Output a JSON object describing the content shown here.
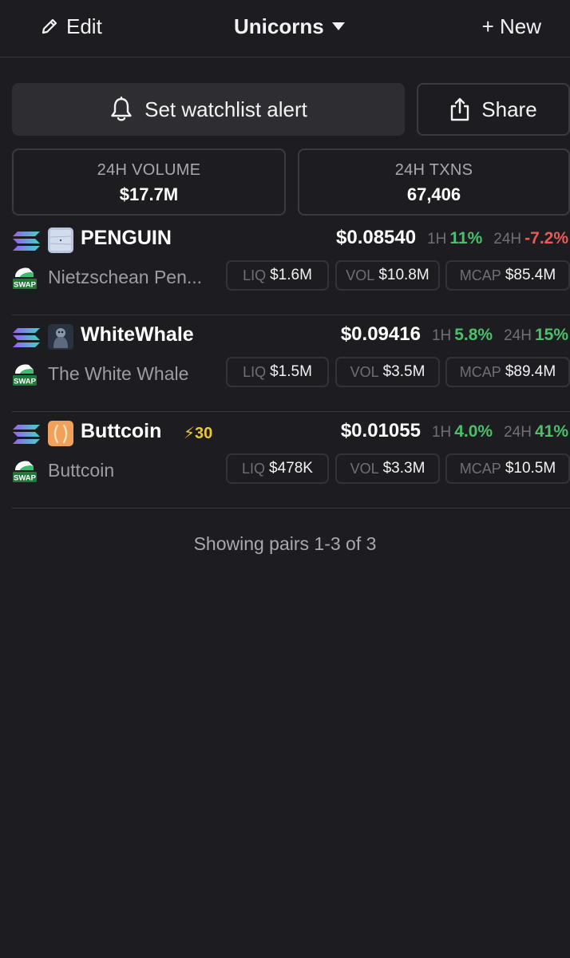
{
  "header": {
    "edit_label": "Edit",
    "title": "Unicorns",
    "new_label": "+ New"
  },
  "actions": {
    "alert_label": "Set watchlist alert",
    "share_label": "Share"
  },
  "stats": {
    "volume_label": "24H VOLUME",
    "volume_value": "$17.7M",
    "txns_label": "24H TXNS",
    "txns_value": "67,406"
  },
  "pairs": [
    {
      "symbol": "PENGUIN",
      "name": "Nietzschean Pen...",
      "boost": "",
      "price": "$0.08540",
      "h1_label": "1H",
      "h1_change": "11%",
      "h24_label": "24H",
      "h24_change": "-7.2%",
      "liq_label": "LIQ",
      "liq": "$1.6M",
      "vol_label": "VOL",
      "vol": "$10.8M",
      "mcap_label": "MCAP",
      "mcap": "$85.4M"
    },
    {
      "symbol": "WhiteWhale",
      "name": "The White Whale",
      "boost": "",
      "price": "$0.09416",
      "h1_label": "1H",
      "h1_change": "5.8%",
      "h24_label": "24H",
      "h24_change": "15%",
      "liq_label": "LIQ",
      "liq": "$1.5M",
      "vol_label": "VOL",
      "vol": "$3.5M",
      "mcap_label": "MCAP",
      "mcap": "$89.4M"
    },
    {
      "symbol": "Buttcoin",
      "name": "Buttcoin",
      "boost": "⚡30",
      "price": "$0.01055",
      "h1_label": "1H",
      "h1_change": "4.0%",
      "h24_label": "24H",
      "h24_change": "41%",
      "liq_label": "LIQ",
      "liq": "$478K",
      "vol_label": "VOL",
      "vol": "$3.3M",
      "mcap_label": "MCAP",
      "mcap": "$10.5M"
    }
  ],
  "dex_badge": "SWAP",
  "footer": "Showing pairs 1-3 of 3",
  "colors": {
    "background": "#1d1d21",
    "positive": "#4cbf6a",
    "negative": "#e65a5a",
    "boost": "#e9c83a"
  },
  "icons": {
    "edit": "pencil-icon",
    "dropdown": "caret-down-icon",
    "alert": "bell-icon",
    "share": "share-icon",
    "chain": "solana-icon",
    "dex": "raydium-swap-icon"
  }
}
